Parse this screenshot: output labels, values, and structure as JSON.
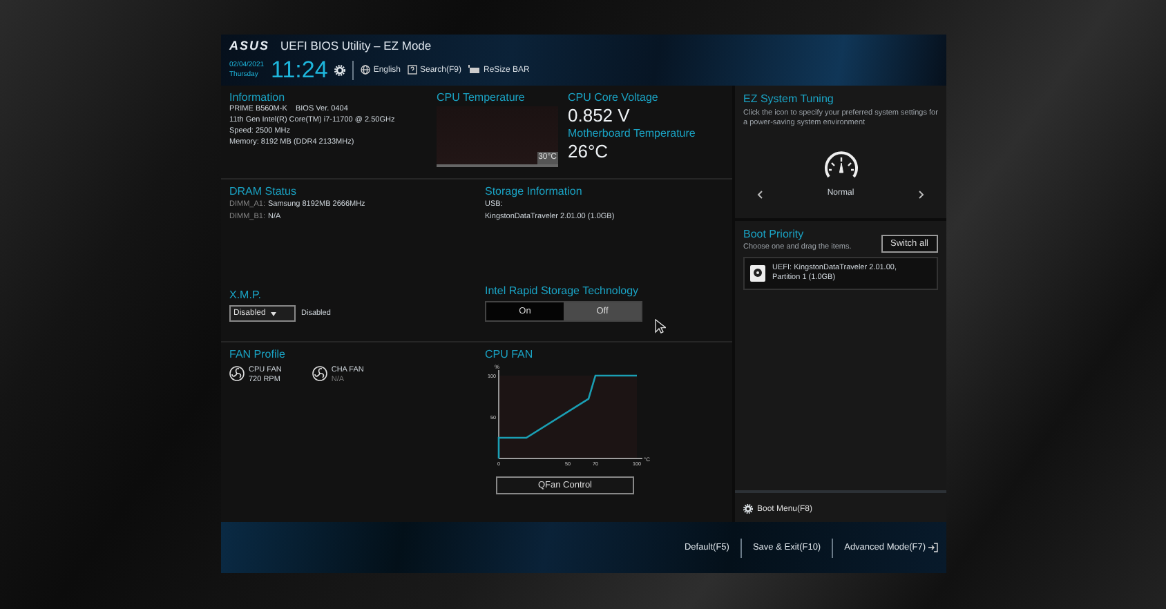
{
  "header": {
    "logo": "ASUS",
    "title": "UEFI BIOS Utility – EZ Mode",
    "date": "02/04/2021",
    "weekday": "Thursday",
    "time": "11:24",
    "menu": [
      {
        "kind": "globe",
        "label": "English"
      },
      {
        "kind": "search",
        "label": "Search(F9)"
      },
      {
        "kind": "card",
        "label": "ReSize BAR"
      }
    ]
  },
  "information": {
    "title": "Information",
    "lines": [
      "PRIME B560M-K    BIOS Ver. 0404",
      "11th Gen Intel(R) Core(TM) i7-11700 @ 2.50GHz",
      "Speed: 2500 MHz",
      "Memory: 8192 MB (DDR4 2133MHz)"
    ]
  },
  "cpu_temperature": {
    "title": "CPU Temperature",
    "reading": "30°C"
  },
  "cpu_core_voltage": {
    "title": "CPU Core Voltage",
    "value": "0.852 V"
  },
  "motherboard_temperature": {
    "title": "Motherboard Temperature",
    "value": "26°C"
  },
  "dram_status": {
    "title": "DRAM Status",
    "slots": [
      {
        "slot": "DIMM_A1:",
        "value": "Samsung 8192MB 2666MHz"
      },
      {
        "slot": "DIMM_B1:",
        "value": "N/A"
      }
    ]
  },
  "storage_information": {
    "title": "Storage Information",
    "lines": [
      "USB:",
      "KingstonDataTraveler 2.01.00 (1.0GB)"
    ]
  },
  "xmp": {
    "title": "X.M.P.",
    "value": "Disabled",
    "status": "Disabled"
  },
  "irst": {
    "title": "Intel Rapid Storage Technology",
    "options": [
      {
        "label": "On",
        "selected": false
      },
      {
        "label": "Off",
        "selected": true
      }
    ]
  },
  "fan_profile": {
    "title": "FAN Profile",
    "fans": [
      {
        "name": "CPU FAN",
        "reading": "720 RPM",
        "disabled": false
      },
      {
        "name": "CHA FAN",
        "reading": "N/A",
        "disabled": true
      }
    ]
  },
  "cpu_fan": {
    "title": "CPU FAN",
    "button": "QFan Control",
    "chart_data": {
      "type": "line",
      "xlabel": "°C",
      "ylabel": "%",
      "xlim": [
        0,
        100
      ],
      "ylim": [
        0,
        100
      ],
      "xticks": [
        0,
        50,
        70,
        100
      ],
      "yticks": [
        50,
        100
      ],
      "series": [
        {
          "color": "#1a9fb4",
          "values": [
            0,
            25,
            25,
            72,
            100,
            100
          ]
        }
      ],
      "x": [
        0,
        0,
        20,
        65,
        70,
        100
      ]
    }
  },
  "ez_system_tuning": {
    "title": "EZ System Tuning",
    "description": "Click the icon to specify your preferred system settings for a power-saving system environment",
    "mode": "Normal"
  },
  "boot_priority": {
    "title": "Boot Priority",
    "hint": "Choose one and drag the items.",
    "button": "Switch all",
    "items": [
      "UEFI: KingstonDataTraveler 2.01.00, Partition 1 (1.0GB)"
    ]
  },
  "boot_menu": "Boot Menu(F8)",
  "footer": [
    "Default(F5)",
    "Save & Exit(F10)",
    "Advanced Mode(F7)"
  ]
}
